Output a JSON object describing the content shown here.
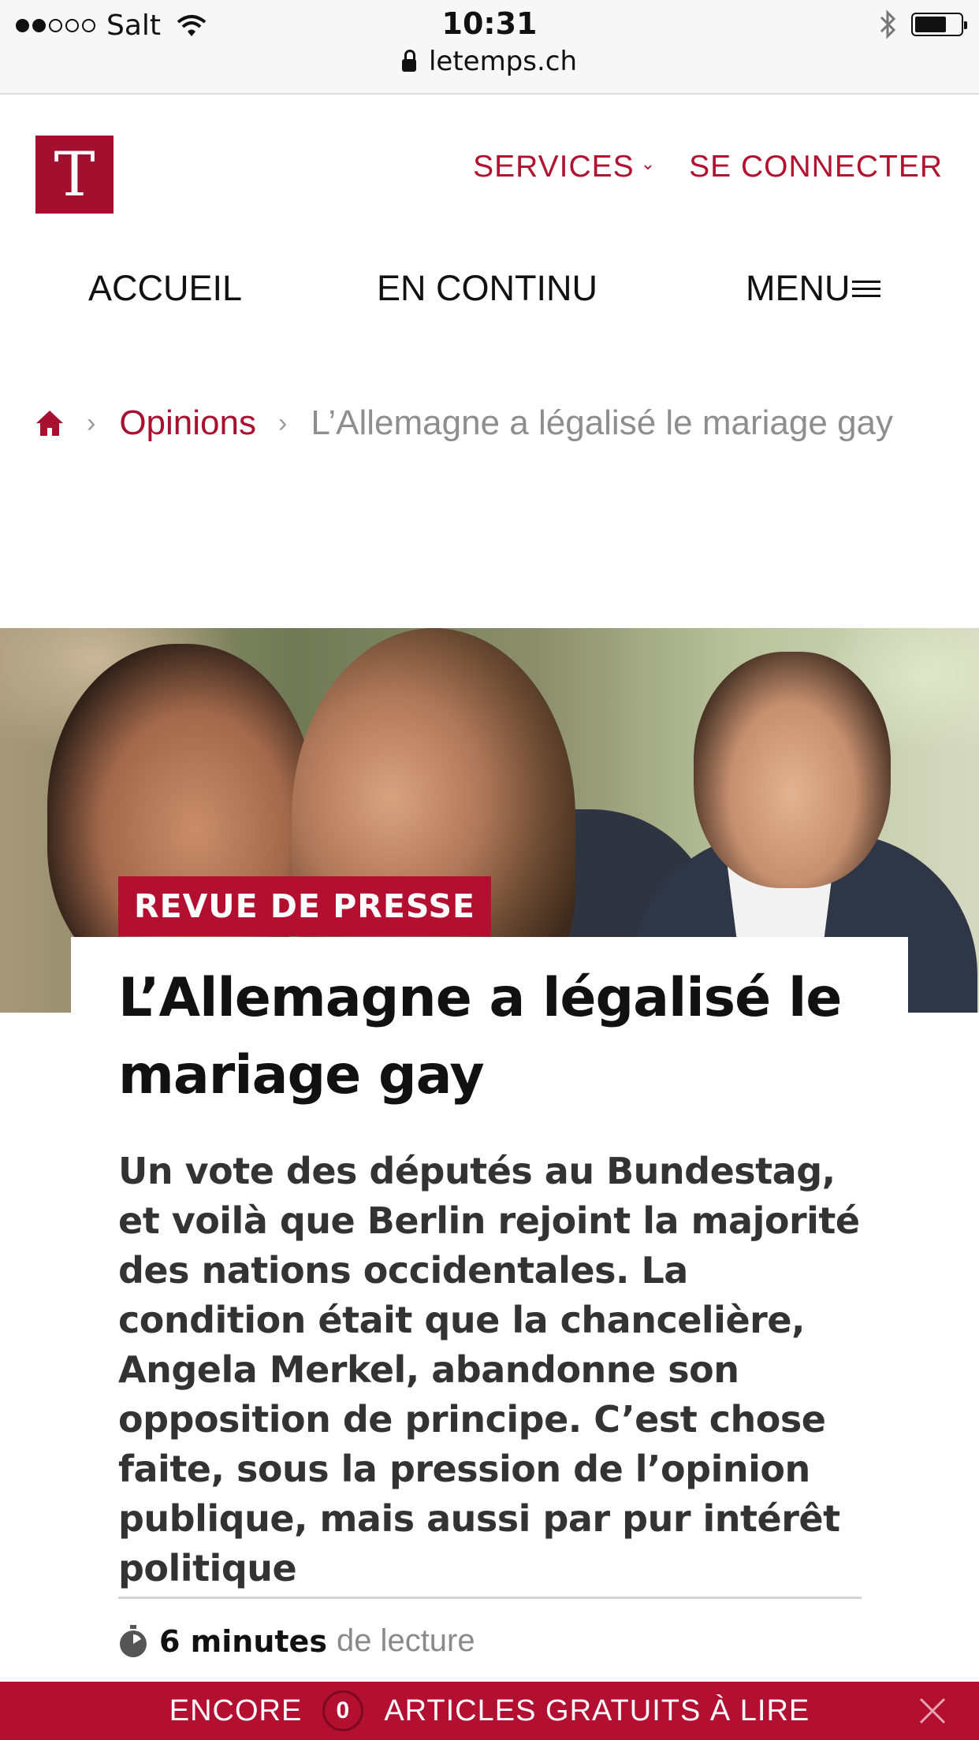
{
  "status_bar": {
    "carrier": "Salt",
    "time": "10:31",
    "url": "letemps.ch",
    "battery_level": 0.7
  },
  "header": {
    "logo_letter": "T",
    "services_label": "SERVICES",
    "login_label": "SE CONNECTER",
    "brand_color": "#a20f2f"
  },
  "nav": {
    "home_label": "ACCUEIL",
    "live_label": "EN CONTINU",
    "menu_label": "MENU"
  },
  "breadcrumb": {
    "section": "Opinions",
    "current": "L’Allemagne a légalisé le mariage gay"
  },
  "article": {
    "tag": "REVUE DE PRESSE",
    "title": "L’Allemagne a légalisé le mariage gay",
    "lead": "Un vote des députés au Bundestag, et voilà que Berlin rejoint la majorité des nations occidentales. La condition était que la chancelière, Angela Merkel, abandonne son opposition de principe. C’est chose faite, sous la pression de l’opinion publique, mais aussi par pur intérêt politique",
    "read_time_strong": "6 minutes",
    "read_time_suffix": "de lecture"
  },
  "banner": {
    "prefix": "ENCORE",
    "count": "0",
    "suffix": "ARTICLES GRATUITS À LIRE"
  },
  "icons": [
    "home-icon",
    "chevron-down-icon",
    "hamburger-icon",
    "lock-icon",
    "wifi-icon",
    "bluetooth-icon",
    "battery-icon",
    "stopwatch-icon",
    "close-icon"
  ]
}
